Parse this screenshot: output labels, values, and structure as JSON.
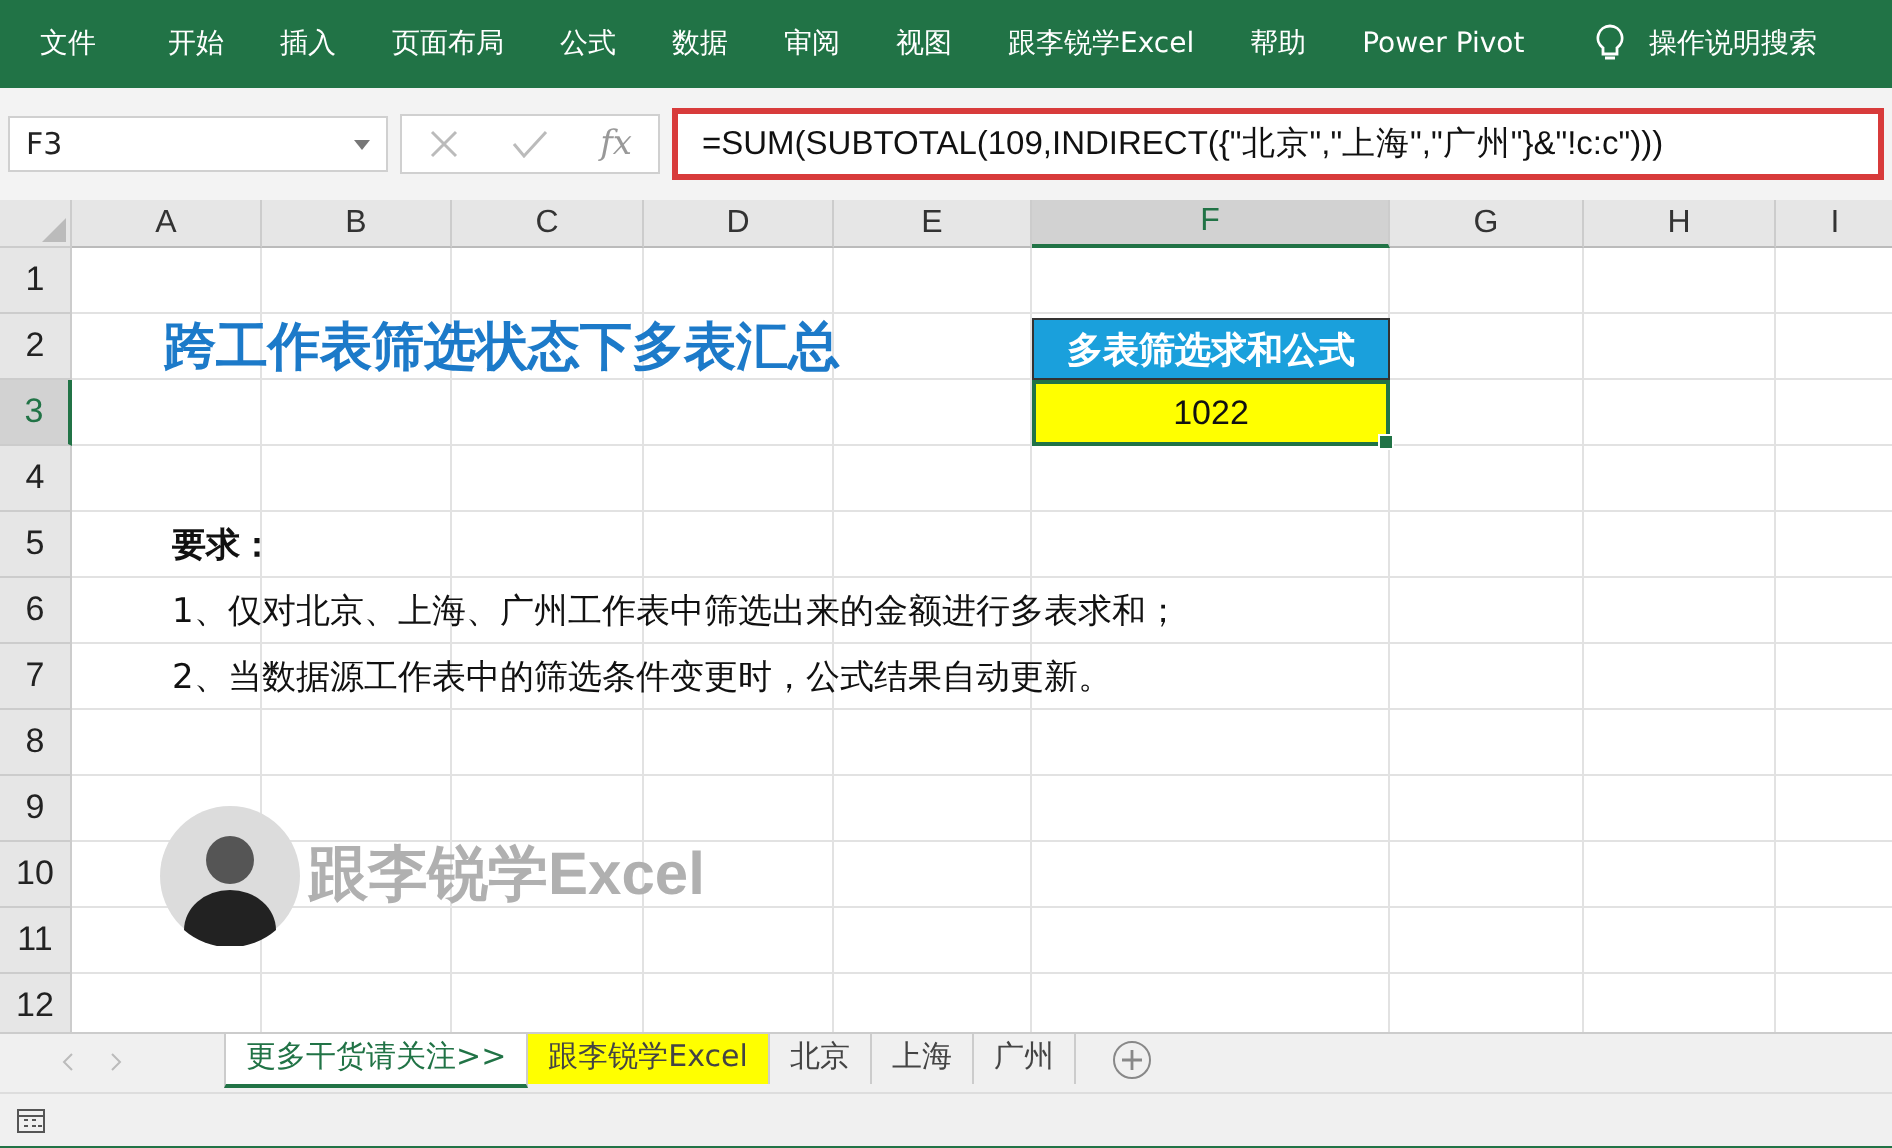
{
  "ribbon": {
    "tabs": [
      {
        "label": "文件"
      },
      {
        "label": "开始"
      },
      {
        "label": "插入"
      },
      {
        "label": "页面布局"
      },
      {
        "label": "公式"
      },
      {
        "label": "数据"
      },
      {
        "label": "审阅"
      },
      {
        "label": "视图"
      },
      {
        "label": "跟李锐学Excel"
      },
      {
        "label": "帮助"
      },
      {
        "label": "Power Pivot"
      }
    ],
    "tell_me": "操作说明搜索"
  },
  "formula_bar": {
    "name_box": "F3",
    "fx": "fx",
    "formula": "=SUM(SUBTOTAL(109,INDIRECT({\"北京\",\"上海\",\"广州\"}&\"!c:c\")))"
  },
  "columns": [
    {
      "label": "A",
      "selected": false
    },
    {
      "label": "B",
      "selected": false
    },
    {
      "label": "C",
      "selected": false
    },
    {
      "label": "D",
      "selected": false
    },
    {
      "label": "E",
      "selected": false
    },
    {
      "label": "F",
      "selected": true
    },
    {
      "label": "G",
      "selected": false
    },
    {
      "label": "H",
      "selected": false
    },
    {
      "label": "I",
      "selected": false
    }
  ],
  "rows": [
    {
      "label": "1",
      "selected": false
    },
    {
      "label": "2",
      "selected": false
    },
    {
      "label": "3",
      "selected": true
    },
    {
      "label": "4",
      "selected": false
    },
    {
      "label": "5",
      "selected": false
    },
    {
      "label": "6",
      "selected": false
    },
    {
      "label": "7",
      "selected": false
    },
    {
      "label": "8",
      "selected": false
    },
    {
      "label": "9",
      "selected": false
    },
    {
      "label": "10",
      "selected": false
    },
    {
      "label": "11",
      "selected": false
    },
    {
      "label": "12",
      "selected": false
    }
  ],
  "sheet": {
    "title": "跨工作表筛选状态下多表汇总",
    "result_header": "多表筛选求和公式",
    "result_value": "1022",
    "requirements": [
      "**要求：**",
      "1、仅对北京、上海、广州工作表中筛选出来的金额进行多表求和；",
      "2、当数据源工作表中的筛选条件变更时，公式结果自动更新。"
    ],
    "logo_text": "跟李锐学Excel"
  },
  "sheet_tabs": [
    {
      "label": "更多干货请关注>>",
      "selected": true,
      "color": "#ffffff"
    },
    {
      "label": "跟李锐学Excel",
      "selected": false,
      "color": "#ffff00"
    },
    {
      "label": "北京",
      "selected": false,
      "color": "#f0f0f0"
    },
    {
      "label": "上海",
      "selected": false,
      "color": "#f0f0f0"
    },
    {
      "label": "广州",
      "selected": false,
      "color": "#f0f0f0"
    }
  ]
}
